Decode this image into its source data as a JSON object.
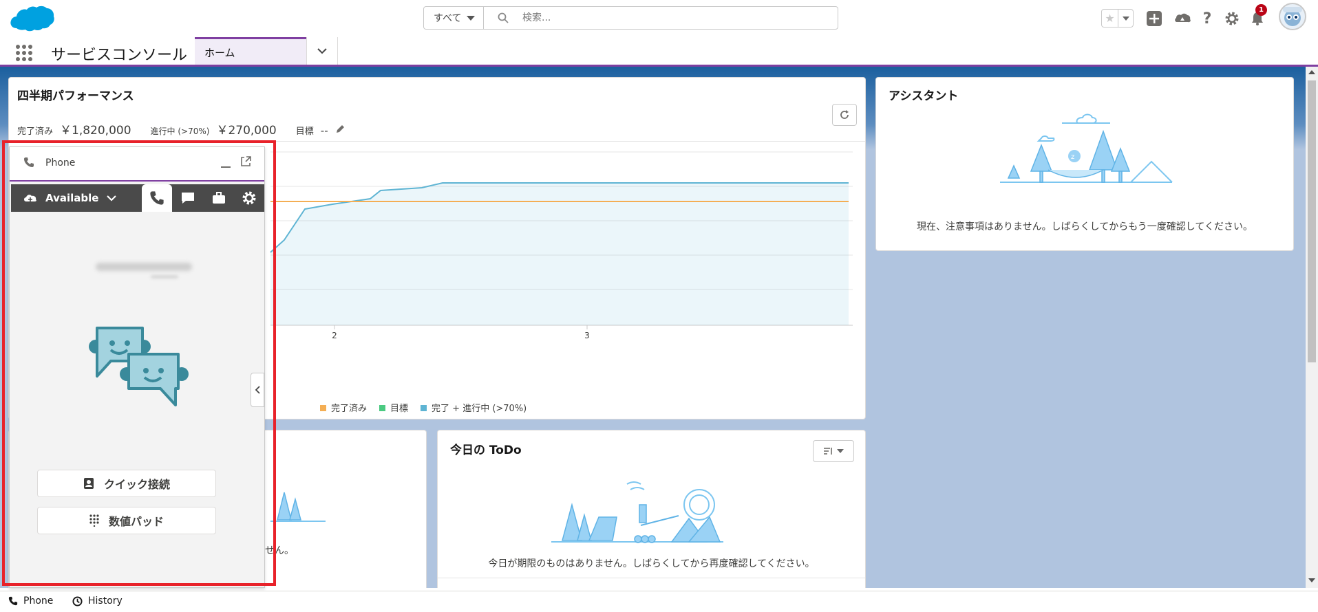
{
  "header": {
    "search_scope": "すべて",
    "search_placeholder": "検索...",
    "notification_count": "1"
  },
  "nav": {
    "app_name": "サービスコンソール",
    "tabs": [
      {
        "label": "ホーム"
      }
    ]
  },
  "performance": {
    "title": "四半期パフォーマンス",
    "closed_label": "完了済み",
    "closed_value": "￥1,820,000",
    "open_label": "進行中 (>70%)",
    "open_value": "￥270,000",
    "goal_label": "目標",
    "goal_value": "--"
  },
  "chart_data": {
    "type": "line",
    "x_ticks": [
      "2",
      "3"
    ],
    "legend": [
      "完了済み",
      "目標",
      "完了 + 進行中 (>70%)"
    ],
    "series_colors": {
      "closed": "#f4ae54",
      "goal": "#4bca81",
      "closed_plus_open": "#5eb4d3"
    }
  },
  "assistant": {
    "title": "アシスタント",
    "empty_message": "現在、注意事項はありません。しばらくしてからもう一度確認してください。"
  },
  "todo": {
    "title": "今日の ToDo",
    "empty_message": "今日が期限のものはありません。しばらくしてから再度確認してください。"
  },
  "partial_card": {
    "text_fragment": "せん。"
  },
  "softphone": {
    "title": "Phone",
    "status": "Available",
    "quick_connect": "クイック接続",
    "number_pad": "数値パッド"
  },
  "utility_bar": {
    "items": [
      {
        "label": "Phone"
      },
      {
        "label": "History"
      }
    ]
  },
  "colors": {
    "brand_blue": "#00a1e0",
    "accent_purple": "#7f3fa1",
    "highlight_red": "#e8222a"
  }
}
